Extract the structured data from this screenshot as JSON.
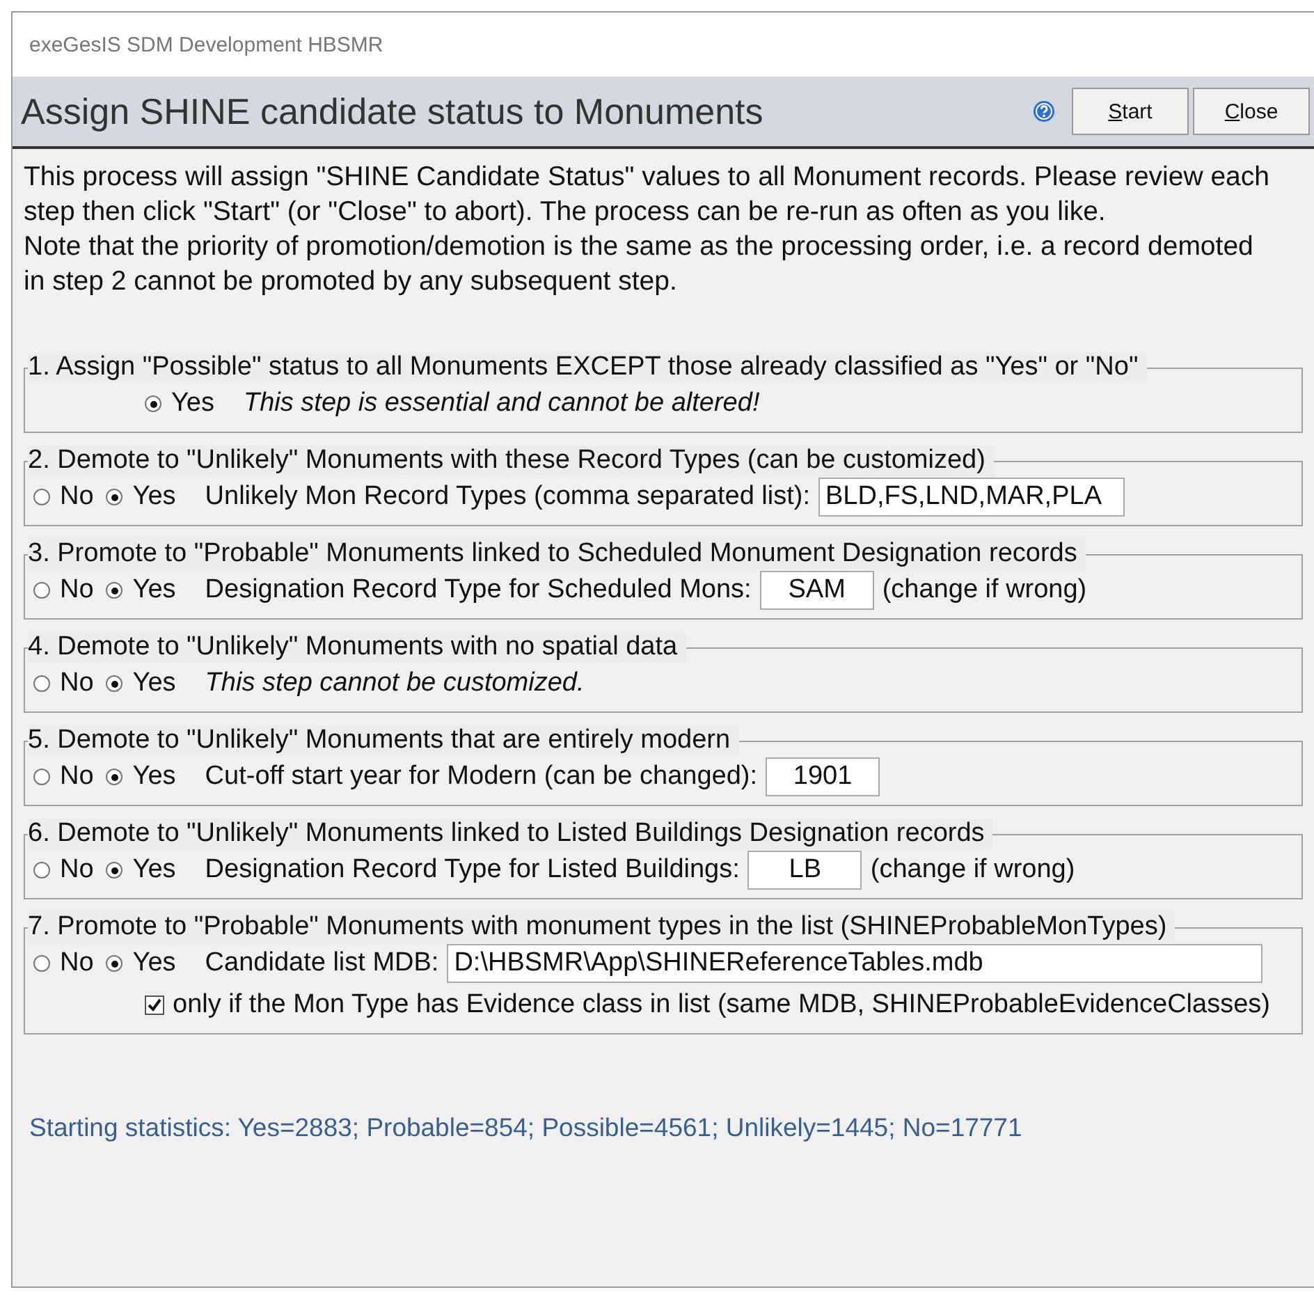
{
  "window": {
    "title": "exeGesIS SDM Development HBSMR"
  },
  "header": {
    "title": "Assign SHINE candidate status to Monuments",
    "buttons": [
      {
        "label": "Start"
      },
      {
        "label": "Close"
      }
    ]
  },
  "intro": [
    "This process will assign \"SHINE Candidate Status\" values to all Monument records. Please review each step then click \"Start\" (or \"Close\" to abort). The process can be re-run as often as you like.",
    "Note that the priority of promotion/demotion is the same as the processing order, i.e. a record demoted in step 2 cannot be promoted by any subsequent step."
  ],
  "steps": [
    {
      "title": "1. Assign \"Possible\" status to all Monuments EXCEPT those already classified as \"Yes\" or \"No\"",
      "options": [
        {
          "label": "Yes",
          "selected": true
        }
      ],
      "detail": {
        "kind": "note",
        "text": "This step is essential and cannot be altered!"
      }
    },
    {
      "title": "2. Demote to \"Unlikely\" Monuments with these Record Types (can be customized)",
      "options": [
        {
          "label": "No",
          "selected": false
        },
        {
          "label": "Yes",
          "selected": true
        }
      ],
      "detail": {
        "kind": "list",
        "label": "Unlikely Mon Record Types (comma separated list):",
        "value": "BLD,FS,LND,MAR,PLA"
      }
    },
    {
      "title": "3. Promote to \"Probable\" Monuments linked to Scheduled Monument Designation records",
      "options": [
        {
          "label": "No",
          "selected": false
        },
        {
          "label": "Yes",
          "selected": true
        }
      ],
      "detail": {
        "kind": "code",
        "label": "Designation Record Type for Scheduled Mons:",
        "value": "SAM",
        "suffix": "(change if wrong)"
      }
    },
    {
      "title": "4. Demote to \"Unlikely\" Monuments with no spatial data",
      "options": [
        {
          "label": "No",
          "selected": false
        },
        {
          "label": "Yes",
          "selected": true
        }
      ],
      "detail": {
        "kind": "note",
        "text": "This step cannot be customized."
      }
    },
    {
      "title": "5. Demote to \"Unlikely\" Monuments that are entirely modern",
      "options": [
        {
          "label": "No",
          "selected": false
        },
        {
          "label": "Yes",
          "selected": true
        }
      ],
      "detail": {
        "kind": "code",
        "label": "Cut-off start year for Modern (can be changed):",
        "value": "1901"
      }
    },
    {
      "title": "6. Demote to \"Unlikely\" Monuments linked to Listed Buildings Designation records",
      "options": [
        {
          "label": "No",
          "selected": false
        },
        {
          "label": "Yes",
          "selected": true
        }
      ],
      "detail": {
        "kind": "code",
        "label": "Designation Record Type for Listed Buildings:",
        "value": "LB",
        "suffix": "(change if wrong)"
      }
    },
    {
      "title": "7. Promote to \"Probable\" Monuments with monument types in the list (SHINEProbableMonTypes)",
      "options": [
        {
          "label": "No",
          "selected": false
        },
        {
          "label": "Yes",
          "selected": true
        }
      ],
      "detail": {
        "kind": "path",
        "label": "Candidate list MDB:",
        "value": "D:\\HBSMR\\App\\SHINEReferenceTables.mdb"
      },
      "checkbox": {
        "label": "only if the Mon Type has Evidence class in list (same MDB, SHINEProbableEvidenceClasses)",
        "checked": true
      }
    }
  ],
  "statistics": "Starting statistics: Yes=2883; Probable=854; Possible=4561; Unlikely=1445; No=17771"
}
